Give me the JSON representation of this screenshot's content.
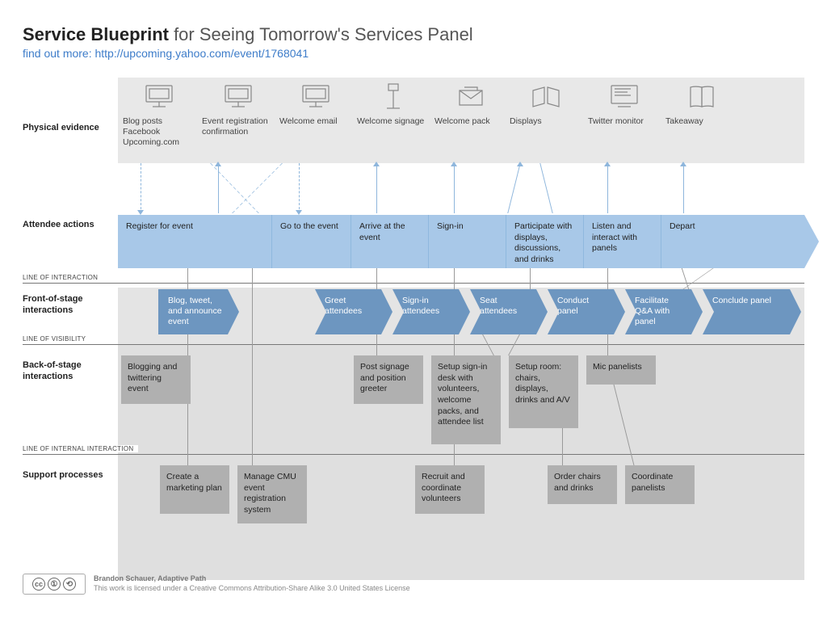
{
  "title_bold": "Service Blueprint",
  "title_rest": " for Seeing Tomorrow's Services Panel",
  "subtitle_link": "find out more: http://upcoming.yahoo.com/event/1768041",
  "row_labels": {
    "physical": "Physical evidence",
    "attendee": "Attendee actions",
    "front": "Front-of-stage interactions",
    "back": "Back-of-stage interactions",
    "support": "Support processes"
  },
  "lines": {
    "interaction": "LINE OF INTERACTION",
    "visibility": "LINE OF VISIBILITY",
    "internal": "LINE OF INTERNAL INTERACTION"
  },
  "physical_evidence": [
    {
      "label": "Blog posts\nFacebook\nUpcoming.com",
      "icon": "monitor"
    },
    {
      "label": "Event registration confirmation",
      "icon": "monitor"
    },
    {
      "label": "Welcome email",
      "icon": "monitor"
    },
    {
      "label": "Welcome signage",
      "icon": "sign"
    },
    {
      "label": "Welcome pack",
      "icon": "envelope"
    },
    {
      "label": "Displays",
      "icon": "displays"
    },
    {
      "label": "Twitter monitor",
      "icon": "tv"
    },
    {
      "label": "Takeaway",
      "icon": "book"
    }
  ],
  "attendee_actions": [
    "Register for event",
    "Go to the event",
    "Arrive at the event",
    "Sign-in",
    "Participate with displays, discussions, and drinks",
    "Listen and interact with panels",
    "Depart"
  ],
  "front_of_stage": [
    "Blog, tweet, and announce event",
    "Greet attendees",
    "Sign-in attendees",
    "Seat attendees",
    "Conduct panel",
    "Facilitate Q&A with panel",
    "Conclude panel"
  ],
  "back_of_stage": [
    "Blogging and twittering event",
    "Post signage and position greeter",
    "Setup sign-in desk with volunteers, welcome packs, and attendee list",
    "Setup room: chairs, displays, drinks and A/V",
    "Mic panelists"
  ],
  "support_processes": [
    "Create a marketing plan",
    "Manage CMU event registration system",
    "Recruit and coordinate volunteers",
    "Order chairs and drinks",
    "Coordinate panelists"
  ],
  "footer": {
    "author": "Brandon Schauer, Adaptive Path",
    "license": "This work is licensed under a Creative Commons Attribution-Share Alike 3.0 United States License"
  }
}
